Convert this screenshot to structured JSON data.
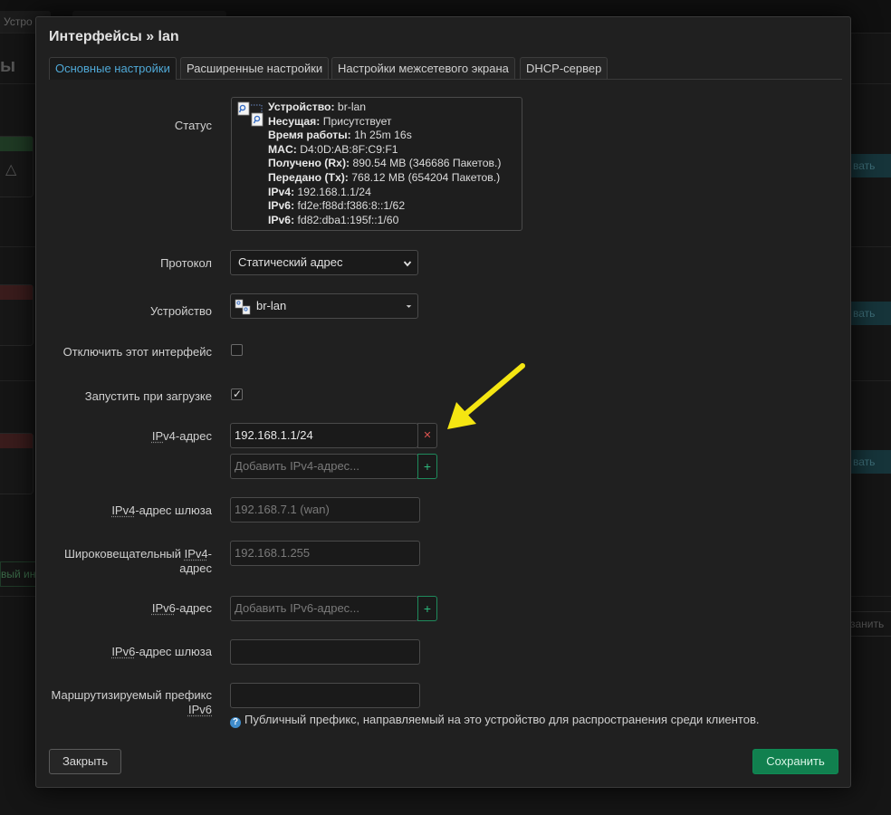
{
  "background": {
    "top_tab": "Устро",
    "heading": "ы",
    "right_buttons": [
      "вать",
      "вать",
      "вать",
      "занить"
    ],
    "left_button": "вый ин"
  },
  "modal": {
    "title": "Интерфейсы » lan",
    "tabs": [
      {
        "label": "Основные настройки",
        "active": true
      },
      {
        "label": "Расширенные настройки",
        "active": false
      },
      {
        "label": "Настройки межсетевого экрана",
        "active": false
      },
      {
        "label": "DHCP-сервер",
        "active": false
      }
    ],
    "status": {
      "label": "Статус",
      "lines": [
        {
          "key": "Устройство:",
          "value": " br-lan"
        },
        {
          "key": "Несущая:",
          "value": " Присутствует"
        },
        {
          "key": "Время работы:",
          "value": " 1h 25m 16s"
        },
        {
          "key": "MAC:",
          "value": " D4:0D:AB:8F:C9:F1"
        },
        {
          "key": "Получено (Rx):",
          "value": " 890.54 MB (346686 Пакетов.)"
        },
        {
          "key": "Передано (Tx):",
          "value": " 768.12 MB (654204 Пакетов.)"
        },
        {
          "key": "IPv4:",
          "value": " 192.168.1.1/24"
        },
        {
          "key": "IPv6:",
          "value": " fd2e:f88d:f386:8::1/62"
        },
        {
          "key": "IPv6:",
          "value": " fd82:dba1:195f::1/60"
        }
      ]
    },
    "protocol": {
      "label": "Протокол",
      "value": "Статический адрес"
    },
    "device": {
      "label": "Устройство",
      "value": "br-lan"
    },
    "disable_iface": {
      "label": "Отключить этот интерфейс",
      "checked": false
    },
    "autostart": {
      "label": "Запустить при загрузке",
      "checked": true
    },
    "ipv4_address": {
      "label_u": "IP",
      "label_rest": "v4-адрес",
      "value": "192.168.1.1/24",
      "add_placeholder": "Добавить IPv4-адрес..."
    },
    "ipv4_gateway": {
      "label_u": "IPv4",
      "label_rest": "-адрес шлюза",
      "placeholder": "192.168.7.1 (wan)"
    },
    "ipv4_broadcast": {
      "label_line1": "Широковещательный ",
      "label_u": "IPv4",
      "label_dash": "-",
      "label_line2": "адрес",
      "placeholder": "192.168.1.255"
    },
    "ipv6_address": {
      "label_u": "IPv6",
      "label_rest": "-адрес",
      "add_placeholder": "Добавить IPv6-адрес..."
    },
    "ipv6_gateway": {
      "label_u": "IPv6",
      "label_rest": "-адрес шлюза",
      "value": ""
    },
    "ipv6_prefix": {
      "label_line1": "Маршрутизируемый префикс",
      "label_line2": "IPv6",
      "value": "",
      "hint": "Публичный префикс, направляемый на это устройство для распространения среди клиентов."
    },
    "close_label": "Закрыть",
    "save_label": "Сохранить"
  },
  "colors": {
    "active_tab": "#4fa8d6",
    "save_button": "#11804f",
    "delete_x": "#d9534f",
    "add_plus": "#2dbb7e",
    "annotation_arrow": "#f5e612"
  }
}
